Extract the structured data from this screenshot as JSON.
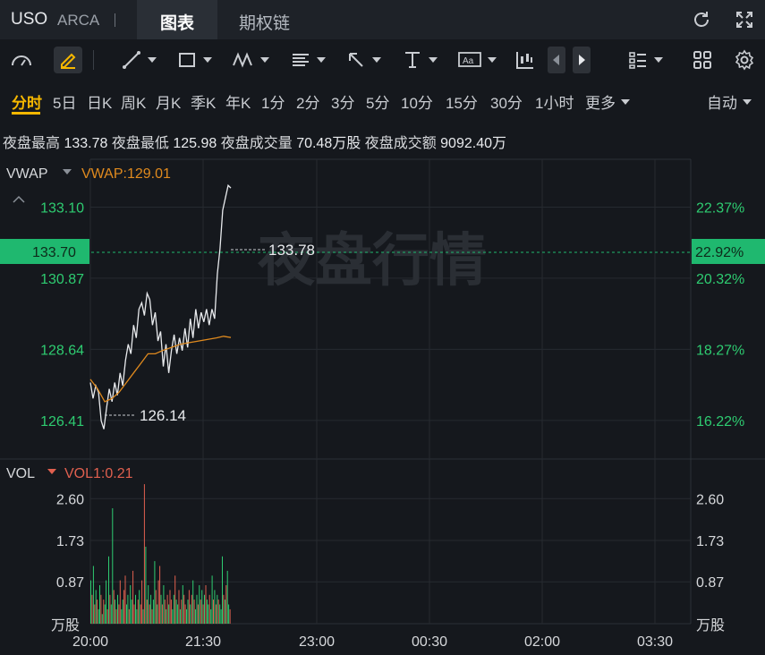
{
  "header": {
    "ticker": "USO",
    "exchange": "ARCA",
    "separator": "|",
    "tabs": [
      {
        "label": "图表",
        "active": true
      },
      {
        "label": "期权链",
        "active": false
      }
    ]
  },
  "toolbar": {
    "icons": [
      "gauge-icon",
      "pencil-icon",
      "line-tool-icon",
      "rectangle-tool-icon",
      "pattern-tool-icon",
      "fib-tool-icon",
      "arrow-tool-icon",
      "text-tool-icon",
      "annotation-tool-icon",
      "candle-type-icon",
      "prev-icon",
      "next-icon",
      "list-layout-icon",
      "grid-layout-icon",
      "settings-icon"
    ],
    "text_tool_label": "Aa"
  },
  "periods": {
    "items": [
      "分时",
      "5日",
      "日K",
      "周K",
      "月K",
      "季K",
      "年K",
      "1分",
      "2分",
      "3分",
      "5分",
      "10分",
      "15分",
      "30分",
      "1小时",
      "更多"
    ],
    "active": "分时",
    "right_label": "自动"
  },
  "stats": {
    "high_label": "夜盘最高",
    "high": "133.78",
    "low_label": "夜盘最低",
    "low": "125.98",
    "vol_label": "夜盘成交量",
    "vol": "70.48万股",
    "amt_label": "夜盘成交额",
    "amt": "9092.40万"
  },
  "price_panel": {
    "indicator": "VWAP",
    "indicator_value": "VWAP:129.01",
    "collapse_glyph": "^",
    "current_price": "133.70",
    "current_pct": "22.92%",
    "high_marker": "133.78",
    "low_marker": "126.14",
    "watermark": "夜盘行情",
    "y_left": [
      "133.10",
      "130.87",
      "128.64",
      "126.41"
    ],
    "y_right": [
      "22.37%",
      "20.32%",
      "18.27%",
      "16.22%"
    ]
  },
  "volume_panel": {
    "indicator": "VOL",
    "indicator_value": "VOL1:0.21",
    "y_left": [
      "2.60",
      "1.73",
      "0.87"
    ],
    "y_right": [
      "2.60",
      "1.73",
      "0.87"
    ],
    "unit": "万股"
  },
  "x_axis": [
    "20:00",
    "21:30",
    "23:00",
    "00:30",
    "02:00",
    "03:30"
  ],
  "colors": {
    "up": "#2ecc71",
    "down": "#e0604f",
    "vwap": "#e08a1e",
    "price_line": "#e8eaed",
    "accent": "#f5b700",
    "price_tag": "#1fb86f"
  },
  "chart_data": {
    "type": "line",
    "x_labels": [
      "20:00",
      "21:30",
      "23:00",
      "00:30",
      "02:00",
      "03:30"
    ],
    "price_ylim": [
      125.2,
      134.6
    ],
    "price_points": [
      [
        0,
        127.6
      ],
      [
        3,
        127.1
      ],
      [
        6,
        127.5
      ],
      [
        9,
        127.3
      ],
      [
        12,
        126.4
      ],
      [
        15,
        126.14
      ],
      [
        18,
        126.8
      ],
      [
        21,
        127.4
      ],
      [
        24,
        127.0
      ],
      [
        27,
        127.6
      ],
      [
        30,
        127.2
      ],
      [
        33,
        127.9
      ],
      [
        36,
        127.5
      ],
      [
        39,
        128.3
      ],
      [
        42,
        128.8
      ],
      [
        45,
        128.5
      ],
      [
        48,
        129.4
      ],
      [
        51,
        129.0
      ],
      [
        54,
        129.9
      ],
      [
        57,
        130.1
      ],
      [
        60,
        129.7
      ],
      [
        63,
        130.4
      ],
      [
        66,
        130.2
      ],
      [
        69,
        129.4
      ],
      [
        72,
        129.8
      ],
      [
        75,
        128.9
      ],
      [
        78,
        129.2
      ],
      [
        81,
        128.1
      ],
      [
        84,
        128.8
      ],
      [
        87,
        127.9
      ],
      [
        90,
        128.6
      ],
      [
        93,
        129.1
      ],
      [
        96,
        128.5
      ],
      [
        99,
        129.0
      ],
      [
        102,
        128.6
      ],
      [
        105,
        129.3
      ],
      [
        108,
        128.7
      ],
      [
        111,
        129.6
      ],
      [
        114,
        129.0
      ],
      [
        117,
        129.9
      ],
      [
        120,
        129.3
      ],
      [
        123,
        129.8
      ],
      [
        126,
        129.5
      ],
      [
        129,
        129.9
      ],
      [
        132,
        129.4
      ],
      [
        135,
        129.9
      ],
      [
        138,
        129.6
      ],
      [
        141,
        131.0
      ],
      [
        144,
        131.8
      ],
      [
        147,
        133.0
      ],
      [
        150,
        133.4
      ],
      [
        153,
        133.78
      ],
      [
        156,
        133.7
      ]
    ],
    "vwap_points": [
      [
        0,
        127.7
      ],
      [
        8,
        127.4
      ],
      [
        16,
        127.0
      ],
      [
        24,
        127.1
      ],
      [
        32,
        127.3
      ],
      [
        40,
        127.6
      ],
      [
        48,
        127.9
      ],
      [
        56,
        128.2
      ],
      [
        64,
        128.5
      ],
      [
        72,
        128.5
      ],
      [
        80,
        128.6
      ],
      [
        90,
        128.7
      ],
      [
        100,
        128.8
      ],
      [
        110,
        128.85
      ],
      [
        120,
        128.9
      ],
      [
        130,
        128.95
      ],
      [
        140,
        129.0
      ],
      [
        148,
        129.05
      ],
      [
        156,
        129.01
      ]
    ],
    "volume_ylim": [
      0,
      3.2
    ],
    "volume_bars": [
      [
        0.9,
        1
      ],
      [
        0.6,
        0
      ],
      [
        1.2,
        1
      ],
      [
        0.4,
        0
      ],
      [
        0.7,
        1
      ],
      [
        0.5,
        0
      ],
      [
        0.3,
        1
      ],
      [
        0.8,
        1
      ],
      [
        0.6,
        0
      ],
      [
        0.2,
        1
      ],
      [
        0.5,
        0
      ],
      [
        0.4,
        1
      ],
      [
        0.9,
        1
      ],
      [
        0.3,
        0
      ],
      [
        1.4,
        1
      ],
      [
        0.6,
        0
      ],
      [
        0.4,
        1
      ],
      [
        2.4,
        1
      ],
      [
        0.7,
        0
      ],
      [
        0.5,
        1
      ],
      [
        0.3,
        0
      ],
      [
        0.6,
        1
      ],
      [
        0.4,
        0
      ],
      [
        0.9,
        0
      ],
      [
        0.3,
        1
      ],
      [
        0.5,
        1
      ],
      [
        0.7,
        0
      ],
      [
        1.0,
        0
      ],
      [
        0.4,
        1
      ],
      [
        0.6,
        1
      ],
      [
        0.3,
        0
      ],
      [
        0.8,
        1
      ],
      [
        0.5,
        1
      ],
      [
        1.1,
        0
      ],
      [
        0.4,
        0
      ],
      [
        0.6,
        1
      ],
      [
        0.3,
        1
      ],
      [
        0.5,
        0
      ],
      [
        0.7,
        1
      ],
      [
        0.4,
        0
      ],
      [
        0.9,
        0
      ],
      [
        0.3,
        1
      ],
      [
        2.9,
        0
      ],
      [
        1.6,
        1
      ],
      [
        0.5,
        0
      ],
      [
        0.8,
        1
      ],
      [
        0.4,
        0
      ],
      [
        0.6,
        1
      ],
      [
        0.3,
        0
      ],
      [
        0.5,
        1
      ],
      [
        1.3,
        1
      ],
      [
        0.7,
        0
      ],
      [
        0.4,
        1
      ],
      [
        0.9,
        0
      ],
      [
        1.2,
        0
      ],
      [
        0.6,
        1
      ],
      [
        0.4,
        0
      ],
      [
        0.8,
        1
      ],
      [
        0.5,
        0
      ],
      [
        0.3,
        1
      ],
      [
        0.6,
        0
      ],
      [
        0.4,
        1
      ],
      [
        0.7,
        0
      ],
      [
        0.5,
        0
      ],
      [
        0.3,
        1
      ],
      [
        0.6,
        1
      ],
      [
        1.0,
        0
      ],
      [
        0.5,
        1
      ],
      [
        0.4,
        1
      ],
      [
        0.7,
        0
      ],
      [
        0.3,
        1
      ],
      [
        0.5,
        0
      ],
      [
        0.8,
        1
      ],
      [
        0.6,
        0
      ],
      [
        0.4,
        0
      ],
      [
        0.3,
        1
      ],
      [
        0.5,
        1
      ],
      [
        0.7,
        0
      ],
      [
        0.4,
        1
      ],
      [
        0.6,
        0
      ],
      [
        0.9,
        1
      ],
      [
        0.5,
        0
      ],
      [
        0.3,
        1
      ],
      [
        0.6,
        1
      ],
      [
        0.4,
        0
      ],
      [
        0.8,
        1
      ],
      [
        0.5,
        0
      ],
      [
        0.7,
        1
      ],
      [
        0.4,
        0
      ],
      [
        0.6,
        1
      ],
      [
        0.8,
        0
      ],
      [
        0.5,
        1
      ],
      [
        0.4,
        1
      ],
      [
        0.6,
        0
      ],
      [
        0.3,
        1
      ],
      [
        1.0,
        1
      ],
      [
        0.5,
        0
      ],
      [
        0.7,
        1
      ],
      [
        0.4,
        0
      ],
      [
        0.6,
        1
      ],
      [
        0.5,
        0
      ],
      [
        0.4,
        1
      ],
      [
        0.3,
        1
      ],
      [
        1.4,
        1
      ],
      [
        0.6,
        0
      ],
      [
        0.5,
        1
      ],
      [
        0.8,
        0
      ],
      [
        1.1,
        1
      ],
      [
        0.4,
        1
      ],
      [
        0.3,
        0
      ]
    ]
  }
}
